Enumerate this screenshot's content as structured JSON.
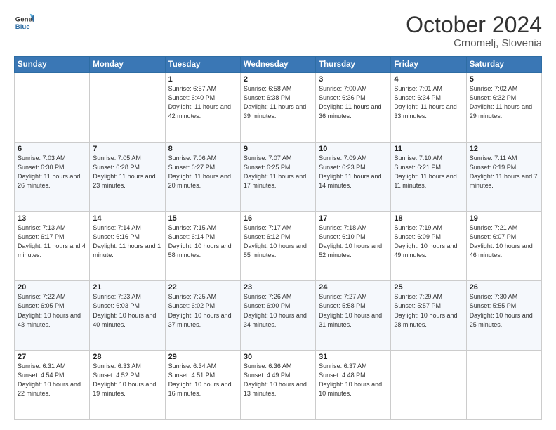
{
  "header": {
    "logo_line1": "General",
    "logo_line2": "Blue",
    "title": "October 2024",
    "subtitle": "Crnomelj, Slovenia"
  },
  "weekdays": [
    "Sunday",
    "Monday",
    "Tuesday",
    "Wednesday",
    "Thursday",
    "Friday",
    "Saturday"
  ],
  "weeks": [
    [
      {
        "day": "",
        "info": ""
      },
      {
        "day": "",
        "info": ""
      },
      {
        "day": "1",
        "info": "Sunrise: 6:57 AM\nSunset: 6:40 PM\nDaylight: 11 hours and 42 minutes."
      },
      {
        "day": "2",
        "info": "Sunrise: 6:58 AM\nSunset: 6:38 PM\nDaylight: 11 hours and 39 minutes."
      },
      {
        "day": "3",
        "info": "Sunrise: 7:00 AM\nSunset: 6:36 PM\nDaylight: 11 hours and 36 minutes."
      },
      {
        "day": "4",
        "info": "Sunrise: 7:01 AM\nSunset: 6:34 PM\nDaylight: 11 hours and 33 minutes."
      },
      {
        "day": "5",
        "info": "Sunrise: 7:02 AM\nSunset: 6:32 PM\nDaylight: 11 hours and 29 minutes."
      }
    ],
    [
      {
        "day": "6",
        "info": "Sunrise: 7:03 AM\nSunset: 6:30 PM\nDaylight: 11 hours and 26 minutes."
      },
      {
        "day": "7",
        "info": "Sunrise: 7:05 AM\nSunset: 6:28 PM\nDaylight: 11 hours and 23 minutes."
      },
      {
        "day": "8",
        "info": "Sunrise: 7:06 AM\nSunset: 6:27 PM\nDaylight: 11 hours and 20 minutes."
      },
      {
        "day": "9",
        "info": "Sunrise: 7:07 AM\nSunset: 6:25 PM\nDaylight: 11 hours and 17 minutes."
      },
      {
        "day": "10",
        "info": "Sunrise: 7:09 AM\nSunset: 6:23 PM\nDaylight: 11 hours and 14 minutes."
      },
      {
        "day": "11",
        "info": "Sunrise: 7:10 AM\nSunset: 6:21 PM\nDaylight: 11 hours and 11 minutes."
      },
      {
        "day": "12",
        "info": "Sunrise: 7:11 AM\nSunset: 6:19 PM\nDaylight: 11 hours and 7 minutes."
      }
    ],
    [
      {
        "day": "13",
        "info": "Sunrise: 7:13 AM\nSunset: 6:17 PM\nDaylight: 11 hours and 4 minutes."
      },
      {
        "day": "14",
        "info": "Sunrise: 7:14 AM\nSunset: 6:16 PM\nDaylight: 11 hours and 1 minute."
      },
      {
        "day": "15",
        "info": "Sunrise: 7:15 AM\nSunset: 6:14 PM\nDaylight: 10 hours and 58 minutes."
      },
      {
        "day": "16",
        "info": "Sunrise: 7:17 AM\nSunset: 6:12 PM\nDaylight: 10 hours and 55 minutes."
      },
      {
        "day": "17",
        "info": "Sunrise: 7:18 AM\nSunset: 6:10 PM\nDaylight: 10 hours and 52 minutes."
      },
      {
        "day": "18",
        "info": "Sunrise: 7:19 AM\nSunset: 6:09 PM\nDaylight: 10 hours and 49 minutes."
      },
      {
        "day": "19",
        "info": "Sunrise: 7:21 AM\nSunset: 6:07 PM\nDaylight: 10 hours and 46 minutes."
      }
    ],
    [
      {
        "day": "20",
        "info": "Sunrise: 7:22 AM\nSunset: 6:05 PM\nDaylight: 10 hours and 43 minutes."
      },
      {
        "day": "21",
        "info": "Sunrise: 7:23 AM\nSunset: 6:03 PM\nDaylight: 10 hours and 40 minutes."
      },
      {
        "day": "22",
        "info": "Sunrise: 7:25 AM\nSunset: 6:02 PM\nDaylight: 10 hours and 37 minutes."
      },
      {
        "day": "23",
        "info": "Sunrise: 7:26 AM\nSunset: 6:00 PM\nDaylight: 10 hours and 34 minutes."
      },
      {
        "day": "24",
        "info": "Sunrise: 7:27 AM\nSunset: 5:58 PM\nDaylight: 10 hours and 31 minutes."
      },
      {
        "day": "25",
        "info": "Sunrise: 7:29 AM\nSunset: 5:57 PM\nDaylight: 10 hours and 28 minutes."
      },
      {
        "day": "26",
        "info": "Sunrise: 7:30 AM\nSunset: 5:55 PM\nDaylight: 10 hours and 25 minutes."
      }
    ],
    [
      {
        "day": "27",
        "info": "Sunrise: 6:31 AM\nSunset: 4:54 PM\nDaylight: 10 hours and 22 minutes."
      },
      {
        "day": "28",
        "info": "Sunrise: 6:33 AM\nSunset: 4:52 PM\nDaylight: 10 hours and 19 minutes."
      },
      {
        "day": "29",
        "info": "Sunrise: 6:34 AM\nSunset: 4:51 PM\nDaylight: 10 hours and 16 minutes."
      },
      {
        "day": "30",
        "info": "Sunrise: 6:36 AM\nSunset: 4:49 PM\nDaylight: 10 hours and 13 minutes."
      },
      {
        "day": "31",
        "info": "Sunrise: 6:37 AM\nSunset: 4:48 PM\nDaylight: 10 hours and 10 minutes."
      },
      {
        "day": "",
        "info": ""
      },
      {
        "day": "",
        "info": ""
      }
    ]
  ]
}
